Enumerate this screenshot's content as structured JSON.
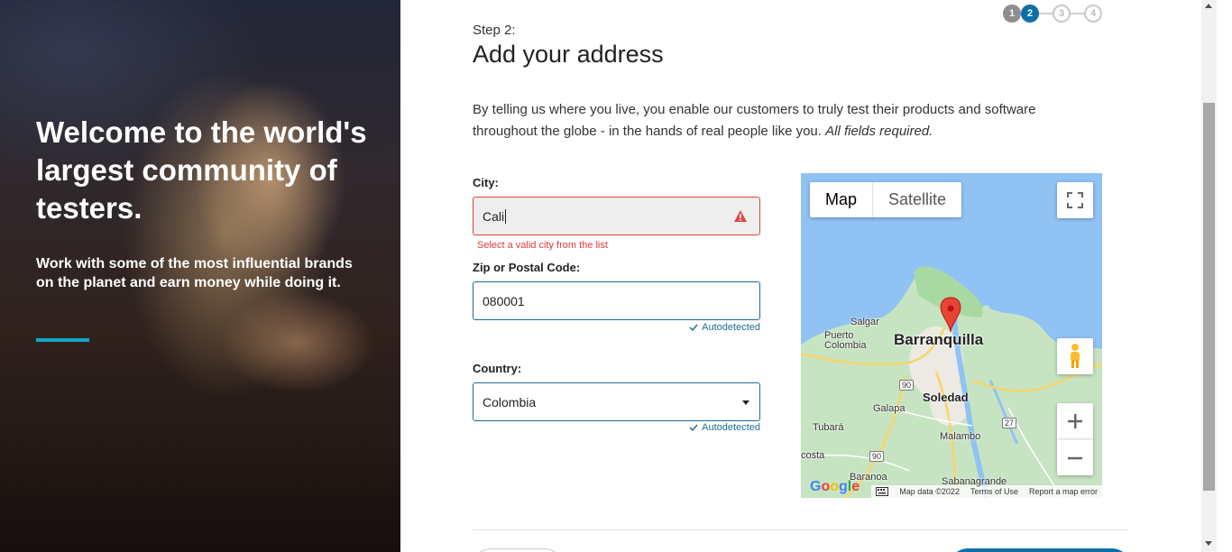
{
  "hero": {
    "title": "Welcome to the world's largest community of testers.",
    "subtitle": "Work with some of the most influential brands on the planet and earn money while doing it.",
    "accent_color": "#12a6c8"
  },
  "steps": {
    "items": [
      "1",
      "2",
      "3",
      "4"
    ],
    "current": 2
  },
  "form": {
    "step_label": "Step 2:",
    "title": "Add your address",
    "intro": "By telling us where you live, you enable our customers to truly test their products and software throughout the globe - in the hands of real people like you.",
    "intro_emphasis": "All fields required.",
    "city": {
      "label": "City:",
      "value": "Cali",
      "error": "Select a valid city from the list",
      "icon": "warning-icon"
    },
    "zip": {
      "label": "Zip or Postal Code:",
      "value": "080001",
      "status": "Autodetected"
    },
    "country": {
      "label": "Country:",
      "value": "Colombia",
      "status": "Autodetected"
    }
  },
  "map": {
    "type_options": [
      "Map",
      "Satellite"
    ],
    "selected_type": "Map",
    "labels": {
      "main_city": "Barranquilla",
      "soledad": "Soledad",
      "salgar": "Salgar",
      "puerto": "Puerto\nColombia",
      "galapa": "Galapa",
      "tubara": "Tubará",
      "malambo": "Malambo",
      "costa": "costa",
      "baranoa": "Baranoa",
      "sabanagrande": "Sabanagrande"
    },
    "road_badges": [
      "90",
      "90",
      "27"
    ],
    "attribution": [
      "Map data ©2022",
      "Terms of Use",
      "Report a map error"
    ],
    "logo": "Google",
    "controls": [
      "fullscreen-icon",
      "pegman-icon",
      "zoom-in-icon",
      "zoom-out-icon"
    ]
  },
  "colors": {
    "primary": "#0f6fa8",
    "error": "#e04545",
    "autodetect": "#1a6d94"
  }
}
